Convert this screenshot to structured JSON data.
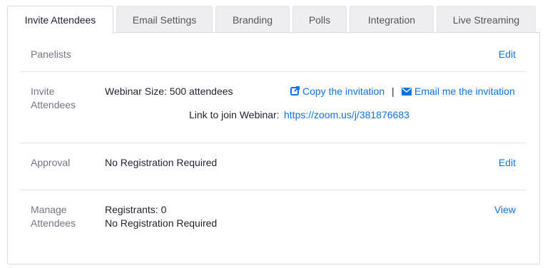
{
  "tabs": [
    {
      "label": "Invite Attendees"
    },
    {
      "label": "Email Settings"
    },
    {
      "label": "Branding"
    },
    {
      "label": "Polls"
    },
    {
      "label": "Integration"
    },
    {
      "label": "Live Streaming"
    }
  ],
  "active_tab": "Invite Attendees",
  "panelists": {
    "label": "Panelists",
    "edit": "Edit"
  },
  "invite": {
    "label": "Invite Attendees",
    "size": "Webinar Size: 500 attendees",
    "copy": "Copy the invitation",
    "separator": "|",
    "email": "Email me the invitation",
    "link_label": "Link to join Webinar:",
    "link_url": "https://zoom.us/j/381876683"
  },
  "approval": {
    "label": "Approval",
    "value": "No Registration Required",
    "edit": "Edit"
  },
  "manage": {
    "label": "Manage Attendees",
    "registrants": "Registrants: 0",
    "value": "No Registration Required",
    "view": "View"
  },
  "colors": {
    "link": "#0e72ed",
    "label": "#747487",
    "text": "#232333",
    "tab_bg": "#eeeef0"
  }
}
